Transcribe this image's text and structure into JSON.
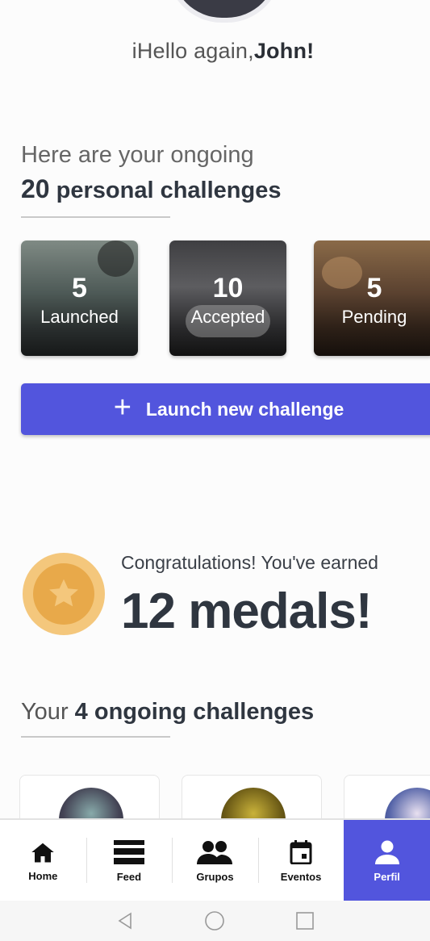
{
  "greeting": {
    "prefix": "iHello again,",
    "name": "John!"
  },
  "overview": {
    "subtitle": "Here are your ongoing",
    "count": "20",
    "title_rest": "personal challenges"
  },
  "cards": [
    {
      "number": "5",
      "label": "Launched"
    },
    {
      "number": "10",
      "label": "Accepted"
    },
    {
      "number": "5",
      "label": "Pending"
    }
  ],
  "launch_button": {
    "label": "Launch new challenge",
    "icon": "plus-icon"
  },
  "medals": {
    "line": "Congratulations! You've earned",
    "big": "12 medals!",
    "icon": "star-medal-icon",
    "colors": {
      "outer": "#f4c77c",
      "inner": "#e8a94a"
    }
  },
  "ongoing": {
    "prefix": "Your",
    "bold": "4 ongoing challenges"
  },
  "nav": [
    {
      "label": "Home",
      "icon": "home-icon"
    },
    {
      "label": "Feed",
      "icon": "feed-icon"
    },
    {
      "label": "Grupos",
      "icon": "groups-icon"
    },
    {
      "label": "Eventos",
      "icon": "calendar-icon"
    },
    {
      "label": "Perfil",
      "icon": "person-icon",
      "active": true
    }
  ],
  "system_nav": [
    "back-icon",
    "home-circle-icon",
    "recents-icon"
  ],
  "colors": {
    "accent": "#5255dd",
    "text_dark": "#2f3640"
  }
}
